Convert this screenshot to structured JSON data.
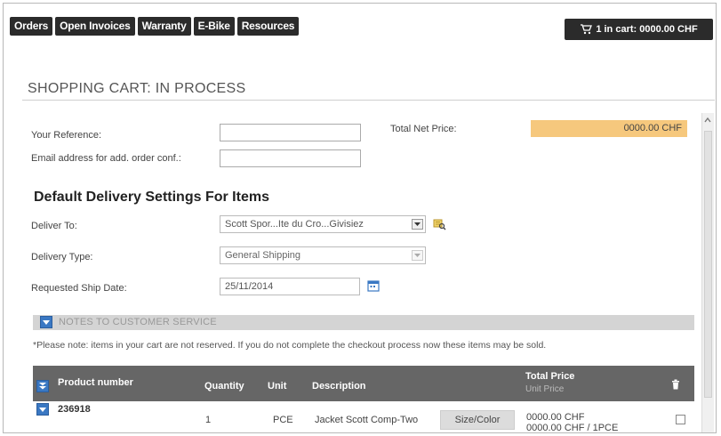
{
  "nav": {
    "items": [
      "Orders",
      "Open Invoices",
      "Warranty",
      "E-Bike",
      "Resources"
    ],
    "cart_label": "1 in cart: 0000.00 CHF"
  },
  "page": {
    "title": "SHOPPING CART: IN PROCESS"
  },
  "form": {
    "reference_label": "Your Reference:",
    "reference_value": "",
    "email_label": "Email address for add. order conf.:",
    "email_value": "",
    "total_label": "Total Net Price:",
    "total_value": "0000.00 CHF"
  },
  "delivery": {
    "title": "Default Delivery Settings For Items",
    "deliver_to_label": "Deliver To:",
    "deliver_to_value": "Scott Spor...Ite du Cro...Givisiez",
    "delivery_type_label": "Delivery Type:",
    "delivery_type_value": "General Shipping",
    "ship_date_label": "Requested Ship Date:",
    "ship_date_value": "25/11/2014"
  },
  "notes": {
    "bar_label": "NOTES TO CUSTOMER SERVICE",
    "warning": "*Please note: items in your cart are not reserved. If you do not complete the checkout process now these items may be sold."
  },
  "table": {
    "headers": {
      "product": "Product number",
      "quantity": "Quantity",
      "unit": "Unit",
      "description": "Description",
      "total": "Total Price",
      "total_sub": "Unit Price"
    },
    "rows": [
      {
        "product": "236918",
        "quantity": "1",
        "unit": "PCE",
        "description": "Jacket Scott Comp-Two",
        "size_button": "Size/Color",
        "total": "0000.00  CHF",
        "unit_price": "0000.00 CHF / 1PCE"
      }
    ]
  },
  "colors": {
    "nav_bg": "#2b2b2b",
    "total_highlight": "#f6c87d",
    "table_header": "#666666",
    "toggle_blue": "#3a78c3"
  }
}
